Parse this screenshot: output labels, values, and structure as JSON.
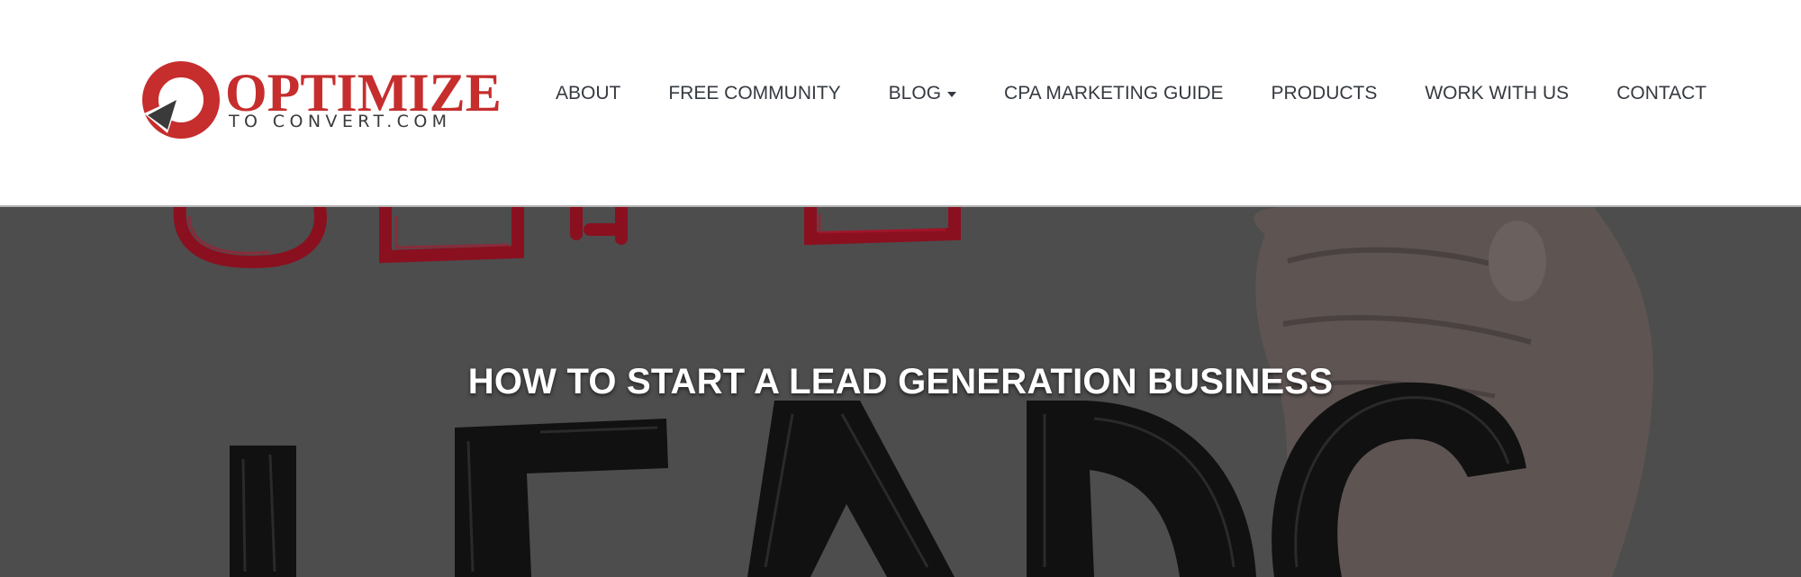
{
  "logo": {
    "word": "OPTIMIZE",
    "sub": "TO CONVERT.COM",
    "brand_red": "#c62d2d",
    "brand_dark": "#3a3a3a"
  },
  "nav": {
    "items": [
      {
        "label": "ABOUT"
      },
      {
        "label": "FREE COMMUNITY"
      },
      {
        "label": "BLOG",
        "has_dropdown": true
      },
      {
        "label": "CPA MARKETING GUIDE"
      },
      {
        "label": "PRODUCTS"
      },
      {
        "label": "WORK WITH US"
      },
      {
        "label": "CONTACT"
      }
    ]
  },
  "hero": {
    "title": "HOW TO START A LEAD GENERATION BUSINESS",
    "overlay_color": "#4d4d4d"
  }
}
